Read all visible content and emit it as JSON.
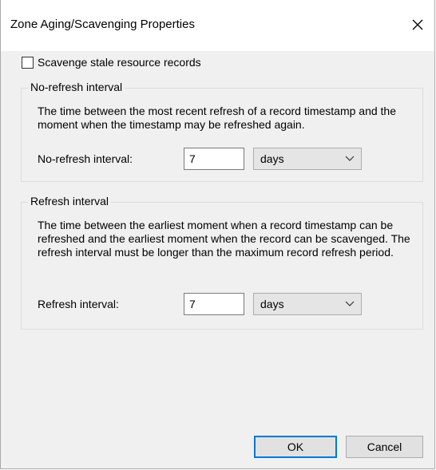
{
  "dialog": {
    "title": "Zone Aging/Scavenging Properties",
    "close_icon": "close-icon"
  },
  "scavenge": {
    "checkbox_label": "Scavenge stale resource records",
    "checked": false
  },
  "no_refresh": {
    "group_title": "No-refresh interval",
    "description": "The time between the most recent refresh of a record timestamp and the moment when the timestamp may be refreshed again.",
    "field_label": "No-refresh interval:",
    "value": "7",
    "unit": "days"
  },
  "refresh": {
    "group_title": "Refresh interval",
    "description": "The time between the earliest moment when a record timestamp can be refreshed and the earliest moment when the record can be scavenged. The refresh interval must be longer than the maximum record refresh period.",
    "field_label": "Refresh interval:",
    "value": "7",
    "unit": "days"
  },
  "buttons": {
    "ok": "OK",
    "cancel": "Cancel"
  }
}
